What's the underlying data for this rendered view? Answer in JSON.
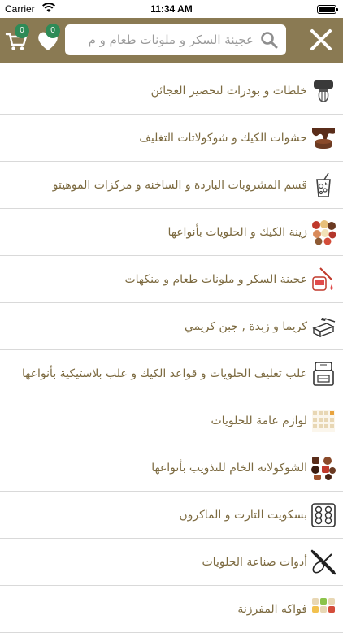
{
  "status_bar": {
    "carrier": "Carrier",
    "time": "11:34 AM"
  },
  "header": {
    "cart_count": "0",
    "favorites_count": "0",
    "search_value": "عجينة السكر و ملونات طعام و م",
    "background_color": "#8a7a53",
    "badge_color": "#2e8b57"
  },
  "menu": {
    "text_color": "#7c6a40",
    "items": [
      {
        "label": "خلطات و بودرات لتحضير العجائن",
        "icon": "mixer-icon"
      },
      {
        "label": "حشوات الكيك و شوكولاتات التغليف",
        "icon": "chocolate-drip-icon"
      },
      {
        "label": "قسم المشروبات الباردة و الساخنه و مركزات الموهيتو",
        "icon": "drink-cup-icon"
      },
      {
        "label": "زينة الكيك و الحلويات بأنواعها",
        "icon": "sweets-decoration-icon"
      },
      {
        "label": "عجينة السكر و ملونات طعام و منكهات",
        "icon": "food-coloring-icon"
      },
      {
        "label": "كريما و زبدة , جبن كريمي",
        "icon": "butter-icon"
      },
      {
        "label": "علب تغليف الحلويات و قواعد الكيك و علب بلاستيكية بأنواعها",
        "icon": "package-box-icon"
      },
      {
        "label": "لوازم عامة للحلويات",
        "icon": "paper-cups-icon"
      },
      {
        "label": "الشوكولاته الخام للتذويب بأنواعها",
        "icon": "chocolate-pieces-icon"
      },
      {
        "label": "بسكويت التارت و الماكرون",
        "icon": "macaron-tray-icon"
      },
      {
        "label": "أدوات صناعة الحلويات",
        "icon": "whisk-rolling-pin-icon"
      },
      {
        "label": "فواكه المفرزنة",
        "icon": "frozen-fruit-icon"
      }
    ]
  }
}
